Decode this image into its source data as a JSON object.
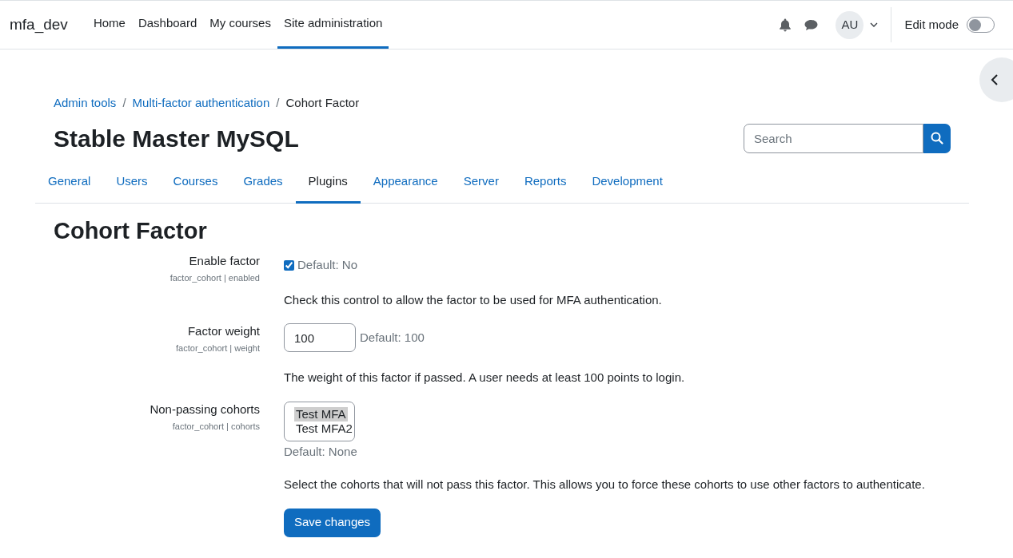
{
  "navbar": {
    "site_name": "mfa_dev",
    "items": [
      {
        "label": "Home",
        "selected": false
      },
      {
        "label": "Dashboard",
        "selected": false
      },
      {
        "label": "My courses",
        "selected": false
      },
      {
        "label": "Site administration",
        "selected": true
      }
    ],
    "avatar": "AU",
    "edit_mode": {
      "label": "Edit mode",
      "on": false
    }
  },
  "breadcrumbs": [
    {
      "kind": "link",
      "label": "Admin tools"
    },
    {
      "kind": "separator",
      "label": "/"
    },
    {
      "kind": "link",
      "label": "Multi-factor authentication"
    },
    {
      "kind": "separator",
      "label": "/"
    },
    {
      "kind": "current",
      "label": "Cohort Factor"
    }
  ],
  "page_title": "Stable Master MySQL",
  "search": {
    "placeholder": "Search"
  },
  "tabs": [
    {
      "label": "General",
      "selected": false
    },
    {
      "label": "Users",
      "selected": false
    },
    {
      "label": "Courses",
      "selected": false
    },
    {
      "label": "Grades",
      "selected": false
    },
    {
      "label": "Plugins",
      "selected": true
    },
    {
      "label": "Appearance",
      "selected": false
    },
    {
      "label": "Server",
      "selected": false
    },
    {
      "label": "Reports",
      "selected": false
    },
    {
      "label": "Development",
      "selected": false
    }
  ],
  "heading": "Cohort Factor",
  "settings": [
    {
      "kind": "checkbox",
      "label": "Enable factor",
      "key": "factor_cohort | enabled",
      "checked": true,
      "default": "Default: No",
      "description": "Check this control to allow the factor to be used for MFA authentication."
    },
    {
      "kind": "text",
      "label": "Factor weight",
      "key": "factor_cohort | weight",
      "value": "100",
      "default": "Default: 100",
      "description": "The weight of this factor if passed. A user needs at least 100 points to login."
    },
    {
      "kind": "multiselect",
      "label": "Non-passing cohorts",
      "key": "factor_cohort | cohorts",
      "options": [
        {
          "label": "Test MFA",
          "selected": true
        },
        {
          "label": "Test MFA2",
          "selected": false
        }
      ],
      "default": "Default: None",
      "description": "Select the cohorts that will not pass this factor. This allows you to force these cohorts to use other factors to authenticate."
    }
  ],
  "save_button": "Save changes"
}
